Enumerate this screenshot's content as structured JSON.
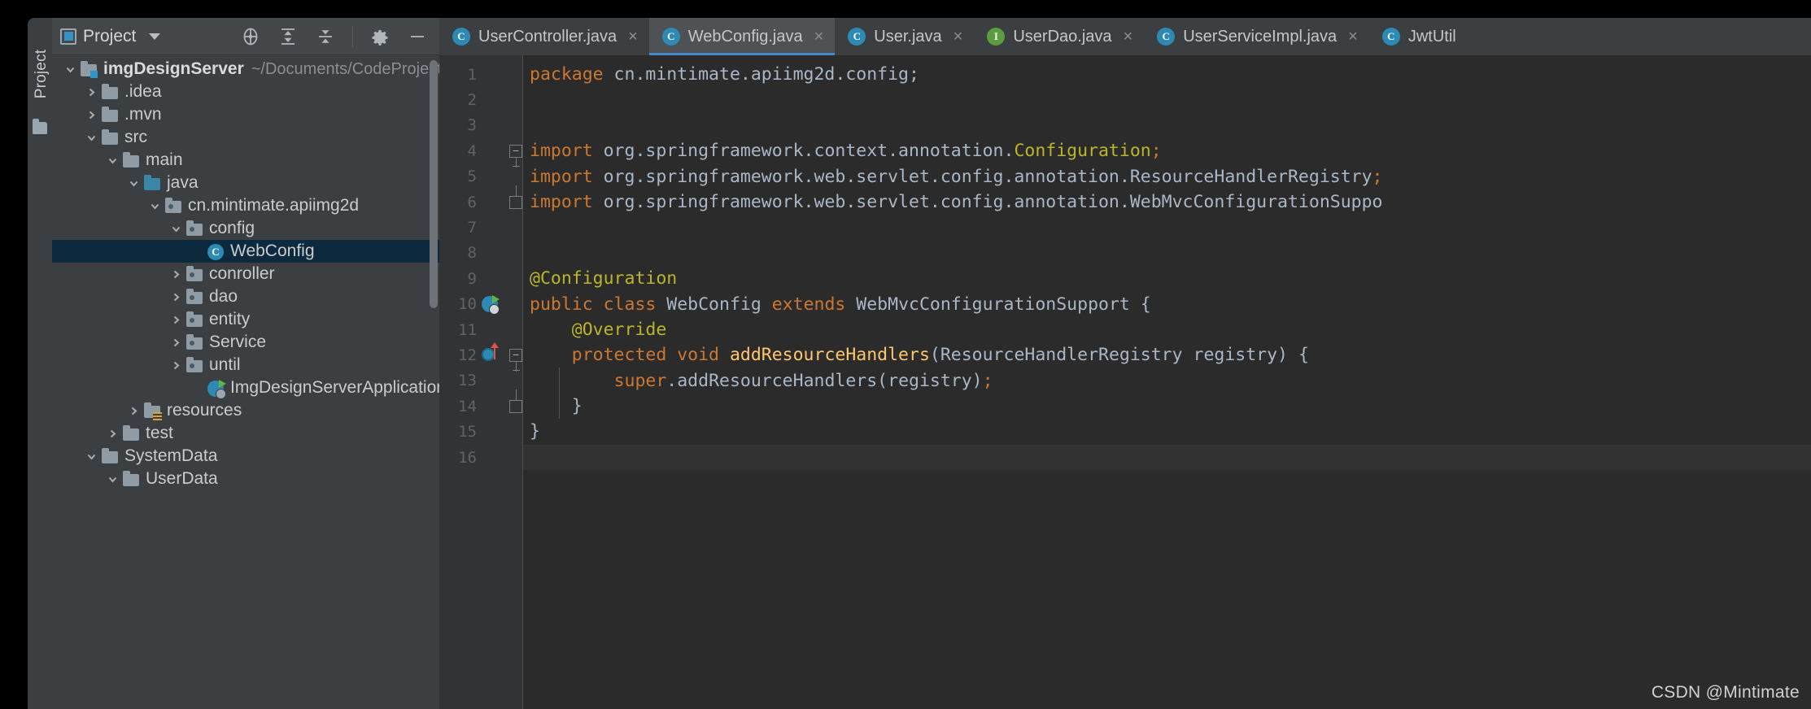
{
  "toolwindow": {
    "stripe_label": "Project",
    "header_title": "Project",
    "tools": [
      {
        "name": "locate-icon",
        "title": "Select Opened File"
      },
      {
        "name": "expand-all-icon",
        "title": "Expand All"
      },
      {
        "name": "collapse-all-icon",
        "title": "Collapse All"
      },
      {
        "name": "settings-gear-icon",
        "title": "Options"
      },
      {
        "name": "hide-icon",
        "title": "Hide"
      }
    ]
  },
  "tree": {
    "items": [
      {
        "indent": 0,
        "arrow": "down",
        "icon": "module-folder",
        "label": "imgDesignServer",
        "bold": true,
        "path": "~/Documents/CodeProject/",
        "selected": false
      },
      {
        "indent": 1,
        "arrow": "right",
        "icon": "folder",
        "label": ".idea",
        "selected": false
      },
      {
        "indent": 1,
        "arrow": "right",
        "icon": "folder",
        "label": ".mvn",
        "selected": false
      },
      {
        "indent": 1,
        "arrow": "down",
        "icon": "folder",
        "label": "src",
        "selected": false
      },
      {
        "indent": 2,
        "arrow": "down",
        "icon": "folder",
        "label": "main",
        "selected": false
      },
      {
        "indent": 3,
        "arrow": "down",
        "icon": "source-folder",
        "label": "java",
        "selected": false
      },
      {
        "indent": 4,
        "arrow": "down",
        "icon": "package-folder",
        "label": "cn.mintimate.apiimg2d",
        "selected": false
      },
      {
        "indent": 5,
        "arrow": "down",
        "icon": "package-folder",
        "label": "config",
        "selected": false
      },
      {
        "indent": 6,
        "arrow": "none",
        "icon": "java-class",
        "label": "WebConfig",
        "selected": true
      },
      {
        "indent": 5,
        "arrow": "right",
        "icon": "package-folder",
        "label": "conroller",
        "selected": false
      },
      {
        "indent": 5,
        "arrow": "right",
        "icon": "package-folder",
        "label": "dao",
        "selected": false
      },
      {
        "indent": 5,
        "arrow": "right",
        "icon": "package-folder",
        "label": "entity",
        "selected": false
      },
      {
        "indent": 5,
        "arrow": "right",
        "icon": "package-folder",
        "label": "Service",
        "selected": false
      },
      {
        "indent": 5,
        "arrow": "right",
        "icon": "package-folder",
        "label": "until",
        "selected": false
      },
      {
        "indent": 6,
        "arrow": "none",
        "icon": "spring-boot-app",
        "label": "ImgDesignServerApplication",
        "selected": false
      },
      {
        "indent": 3,
        "arrow": "right",
        "icon": "resource-folder",
        "label": "resources",
        "selected": false
      },
      {
        "indent": 2,
        "arrow": "right",
        "icon": "folder",
        "label": "test",
        "selected": false
      },
      {
        "indent": 1,
        "arrow": "down",
        "icon": "folder",
        "label": "SystemData",
        "selected": false
      },
      {
        "indent": 2,
        "arrow": "down",
        "icon": "folder",
        "label": "UserData",
        "selected": false
      }
    ]
  },
  "editor": {
    "tabs": [
      {
        "label": "UserController.java",
        "icon": "java-class",
        "active": false,
        "closable": true
      },
      {
        "label": "WebConfig.java",
        "icon": "java-class",
        "active": true,
        "closable": true
      },
      {
        "label": "User.java",
        "icon": "java-class",
        "active": false,
        "closable": true
      },
      {
        "label": "UserDao.java",
        "icon": "java-interface",
        "active": false,
        "closable": true
      },
      {
        "label": "UserServiceImpl.java",
        "icon": "java-class",
        "active": false,
        "closable": true
      },
      {
        "label": "JwtUtil",
        "icon": "java-class",
        "active": false,
        "closable": false
      }
    ],
    "line_numbers": [
      "1",
      "2",
      "3",
      "4",
      "5",
      "6",
      "7",
      "8",
      "9",
      "10",
      "11",
      "12",
      "13",
      "14",
      "15",
      "16"
    ],
    "current_line": 16,
    "gutter_marks": [
      {
        "line": 10,
        "name": "spring-bean-gutter-icon"
      },
      {
        "line": 12,
        "name": "overriding-method-gutter-icon"
      }
    ],
    "fold_marks": [
      {
        "line": 4,
        "type": "open"
      },
      {
        "line": 6,
        "type": "close-b"
      },
      {
        "line": 12,
        "type": "open"
      },
      {
        "line": 14,
        "type": "close-b"
      }
    ],
    "lines": [
      {
        "n": 1,
        "tokens": [
          {
            "t": "package",
            "c": "kw"
          },
          {
            "t": " cn.mintimate.apiimg2d.config;",
            "c": "pln"
          }
        ]
      },
      {
        "n": 2,
        "tokens": []
      },
      {
        "n": 3,
        "tokens": []
      },
      {
        "n": 4,
        "tokens": [
          {
            "t": "import",
            "c": "kw"
          },
          {
            "t": " org.springframework.context.annotation.",
            "c": "pln"
          },
          {
            "t": "Configuration",
            "c": "ann"
          },
          {
            "t": ";",
            "c": "kw"
          }
        ]
      },
      {
        "n": 5,
        "tokens": [
          {
            "t": "import",
            "c": "kw"
          },
          {
            "t": " org.springframework.web.servlet.config.annotation.ResourceHandlerRegistry",
            "c": "pln"
          },
          {
            "t": ";",
            "c": "kw"
          }
        ]
      },
      {
        "n": 6,
        "tokens": [
          {
            "t": "import",
            "c": "kw"
          },
          {
            "t": " org.springframework.web.servlet.config.annotation.WebMvcConfigurationSuppo",
            "c": "pln"
          }
        ]
      },
      {
        "n": 7,
        "tokens": []
      },
      {
        "n": 8,
        "tokens": []
      },
      {
        "n": 9,
        "tokens": [
          {
            "t": "@Configuration",
            "c": "ann"
          }
        ]
      },
      {
        "n": 10,
        "tokens": [
          {
            "t": "public class ",
            "c": "kw"
          },
          {
            "t": "WebConfig ",
            "c": "cls"
          },
          {
            "t": "extends ",
            "c": "kw"
          },
          {
            "t": "WebMvcConfigurationSupport {",
            "c": "cls"
          }
        ]
      },
      {
        "n": 11,
        "tokens": [
          {
            "t": "    ",
            "c": "pln"
          },
          {
            "t": "@Override",
            "c": "ann"
          }
        ]
      },
      {
        "n": 12,
        "tokens": [
          {
            "t": "    ",
            "c": "pln"
          },
          {
            "t": "protected void ",
            "c": "kw"
          },
          {
            "t": "addResourceHandlers",
            "c": "fn"
          },
          {
            "t": "(ResourceHandlerRegistry registry) {",
            "c": "pln"
          }
        ]
      },
      {
        "n": 13,
        "tokens": [
          {
            "t": "        ",
            "c": "pln"
          },
          {
            "t": "super",
            "c": "kw"
          },
          {
            "t": ".addResourceHandlers(registry)",
            "c": "pln"
          },
          {
            "t": ";",
            "c": "kw"
          }
        ]
      },
      {
        "n": 14,
        "tokens": [
          {
            "t": "    }",
            "c": "pln"
          }
        ]
      },
      {
        "n": 15,
        "tokens": [
          {
            "t": "}",
            "c": "pln"
          }
        ]
      },
      {
        "n": 16,
        "tokens": []
      }
    ]
  },
  "watermark": "CSDN @Mintimate",
  "colors": {
    "panel_bg": "#3c3f41",
    "editor_bg": "#2b2b2b",
    "gutter_bg": "#313335",
    "selection_bg": "#0d293e",
    "active_tab_bg": "#4e5254",
    "accent": "#4a88c7",
    "keyword": "#cc7832",
    "annotation": "#bbb529",
    "method": "#ffc66d",
    "text": "#a9b7c6"
  }
}
